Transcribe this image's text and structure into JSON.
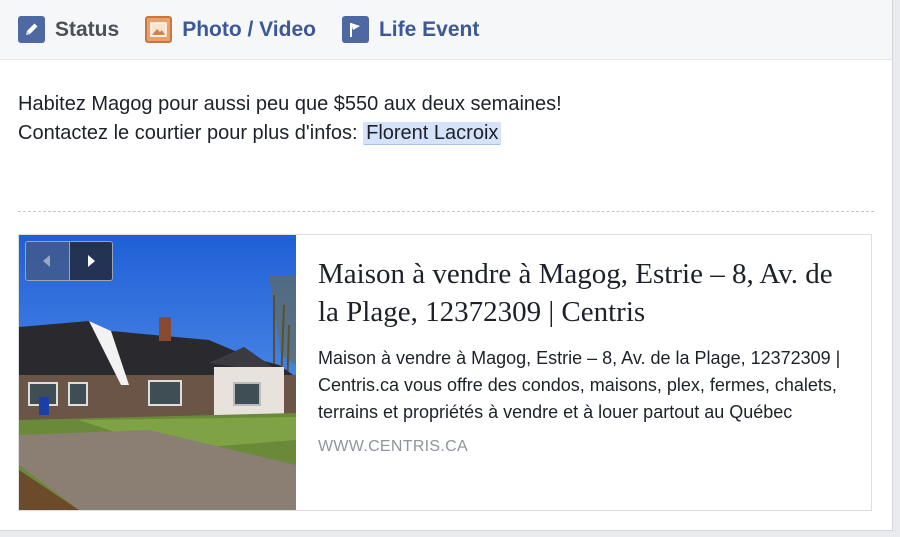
{
  "tabs": [
    {
      "label": "Status",
      "icon": "pencil-icon",
      "active": true
    },
    {
      "label": "Photo / Video",
      "icon": "photo-icon"
    },
    {
      "label": "Life Event",
      "icon": "flag-icon"
    }
  ],
  "post": {
    "line1": "Habitez Magog pour aussi peu que $550 aux deux semaines!",
    "line2_prefix": "Contactez le courtier pour plus d'infos: ",
    "mention": "Florent Lacroix"
  },
  "link_preview": {
    "title": "Maison à vendre à Magog, Estrie – 8, Av. de la Plage, 12372309 | Centris",
    "description": "Maison à vendre à Magog, Estrie – 8, Av. de la Plage, 12372309 | Centris.ca vous offre des condos, maisons, plex, fermes, chalets, terrains et propriétés à vendre et à louer partout au Québec",
    "domain": "WWW.CENTRIS.CA",
    "image": "house-photo"
  },
  "colors": {
    "brand": "#3b5998",
    "mention_bg": "#d4e3fa"
  }
}
